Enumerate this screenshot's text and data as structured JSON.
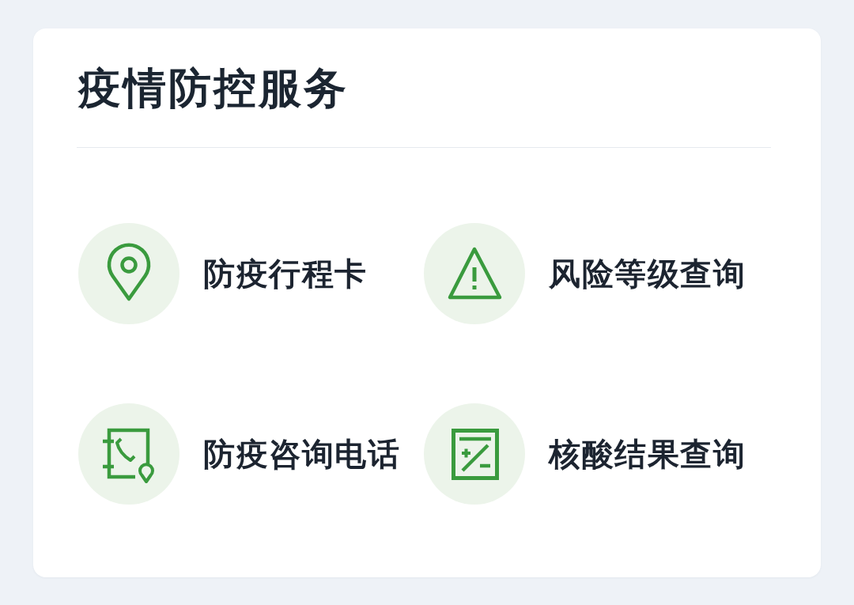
{
  "card": {
    "title": "疫情防控服务",
    "services": [
      {
        "label": "防疫行程卡",
        "kind": "location"
      },
      {
        "label": "风险等级查询",
        "kind": "warning"
      },
      {
        "label": "防疫咨询电话",
        "kind": "phone"
      },
      {
        "label": "核酸结果查询",
        "kind": "test"
      }
    ]
  }
}
